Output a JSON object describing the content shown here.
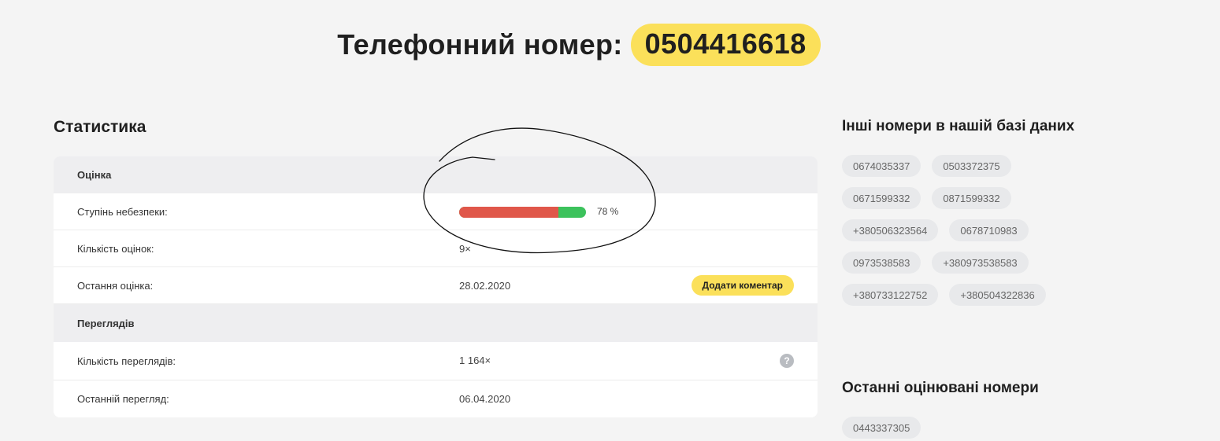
{
  "header": {
    "label": "Телефонний номер:",
    "phone": "0504416618"
  },
  "stats": {
    "heading": "Статистика",
    "rating_section": "Оцінка",
    "danger_label": "Ступінь небезпеки:",
    "danger_percent": 78,
    "danger_text": "78 %",
    "ratings_count_label": "Кількість оцінок:",
    "ratings_count": "9×",
    "last_rating_label": "Остання оцінка:",
    "last_rating": "28.02.2020",
    "add_comment": "Додати коментар",
    "views_section": "Переглядів",
    "views_count_label": "Кількість переглядів:",
    "views_count": "1 164×",
    "help_icon": "question-circle-icon",
    "last_view_label": "Останній перегляд:",
    "last_view": "06.04.2020"
  },
  "other_numbers": {
    "heading": "Інші номери в нашій базі даних",
    "items": [
      "0674035337",
      "0503372375",
      "0671599332",
      "0871599332",
      "+380506323564",
      "0678710983",
      "0973538583",
      "+380973538583",
      "+380733122752",
      "+380504322836"
    ]
  },
  "recent_rated": {
    "heading": "Останні оцінювані номери",
    "items": [
      "0443337305"
    ]
  },
  "colors": {
    "accent_yellow": "#fbe05a",
    "danger_red": "#e0574a",
    "safe_green": "#3cc25c"
  }
}
